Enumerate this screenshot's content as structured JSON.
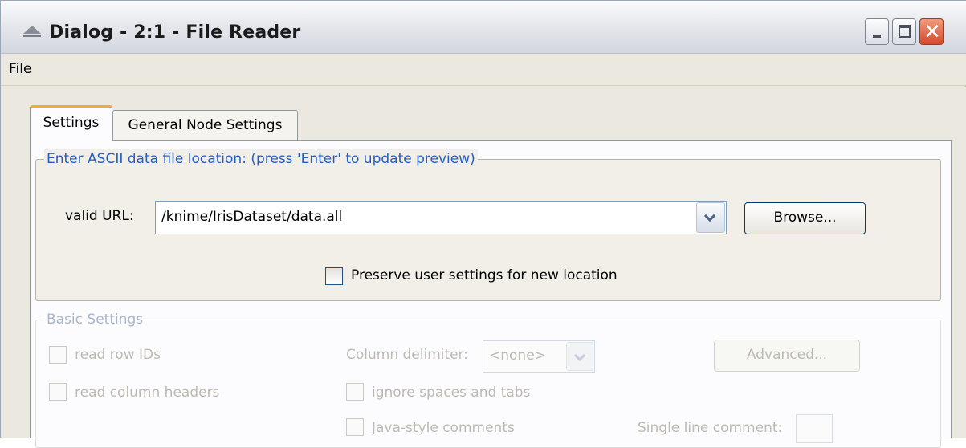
{
  "window": {
    "title": "Dialog - 2:1 - File Reader",
    "controls": {
      "minimize": "minimize",
      "maximize": "maximize",
      "close": "✕"
    }
  },
  "menu": {
    "items": [
      "File"
    ]
  },
  "tabs": [
    {
      "label": "Settings",
      "active": true
    },
    {
      "label": "General Node Settings",
      "active": false
    }
  ],
  "url_group": {
    "title": "Enter ASCII data file location: (press 'Enter' to update preview)",
    "url_label": "valid URL:",
    "url_value": "/knime/IrisDataset/data.all",
    "browse_label": "Browse...",
    "preserve_label": "Preserve user settings for new location",
    "preserve_checked": false
  },
  "basic_group": {
    "title": "Basic Settings",
    "read_row_ids": "read row IDs",
    "read_column_headers": "read column headers",
    "column_delimiter_label": "Column delimiter:",
    "column_delimiter_value": "<none>",
    "ignore_spaces": "ignore spaces and tabs",
    "advanced_label": "Advanced...",
    "java_comments": "Java-style comments",
    "single_line_comment": "Single line comment:"
  },
  "colors": {
    "group_title": "#215dc6",
    "active_tab_accent": "#f1a93b",
    "disabled_text": "#bcbab1"
  }
}
